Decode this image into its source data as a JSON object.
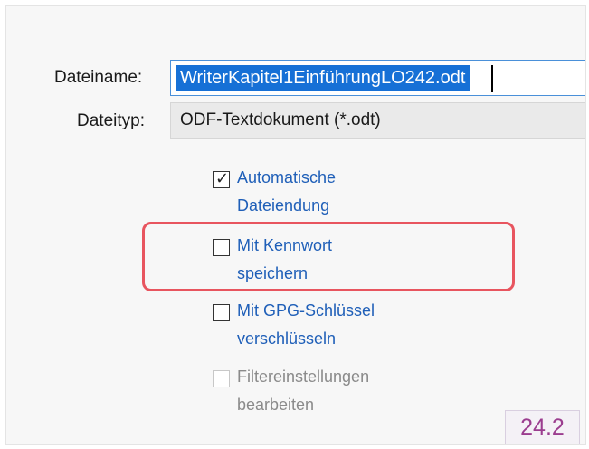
{
  "form": {
    "filename_label": "Dateiname:",
    "filename_value": "WriterKapitel1EinführungLO242.odt",
    "filetype_label": "Dateityp:",
    "filetype_value": "ODF-Textdokument (*.odt)"
  },
  "options": [
    {
      "line1": "Automatische",
      "line2": "Dateiendung",
      "checked": true,
      "enabled": true
    },
    {
      "line1": "Mit Kennwort",
      "line2": "speichern",
      "checked": false,
      "enabled": true
    },
    {
      "line1": "Mit GPG-Schlüssel",
      "line2": "verschlüsseln",
      "checked": false,
      "enabled": true
    },
    {
      "line1": "Filtereinstellungen",
      "line2": "bearbeiten",
      "checked": false,
      "enabled": false
    }
  ],
  "badge": {
    "version": "24.2"
  },
  "colors": {
    "highlight": "#e8555f",
    "link_text": "#1f5fb8",
    "selection": "#1670d6"
  }
}
